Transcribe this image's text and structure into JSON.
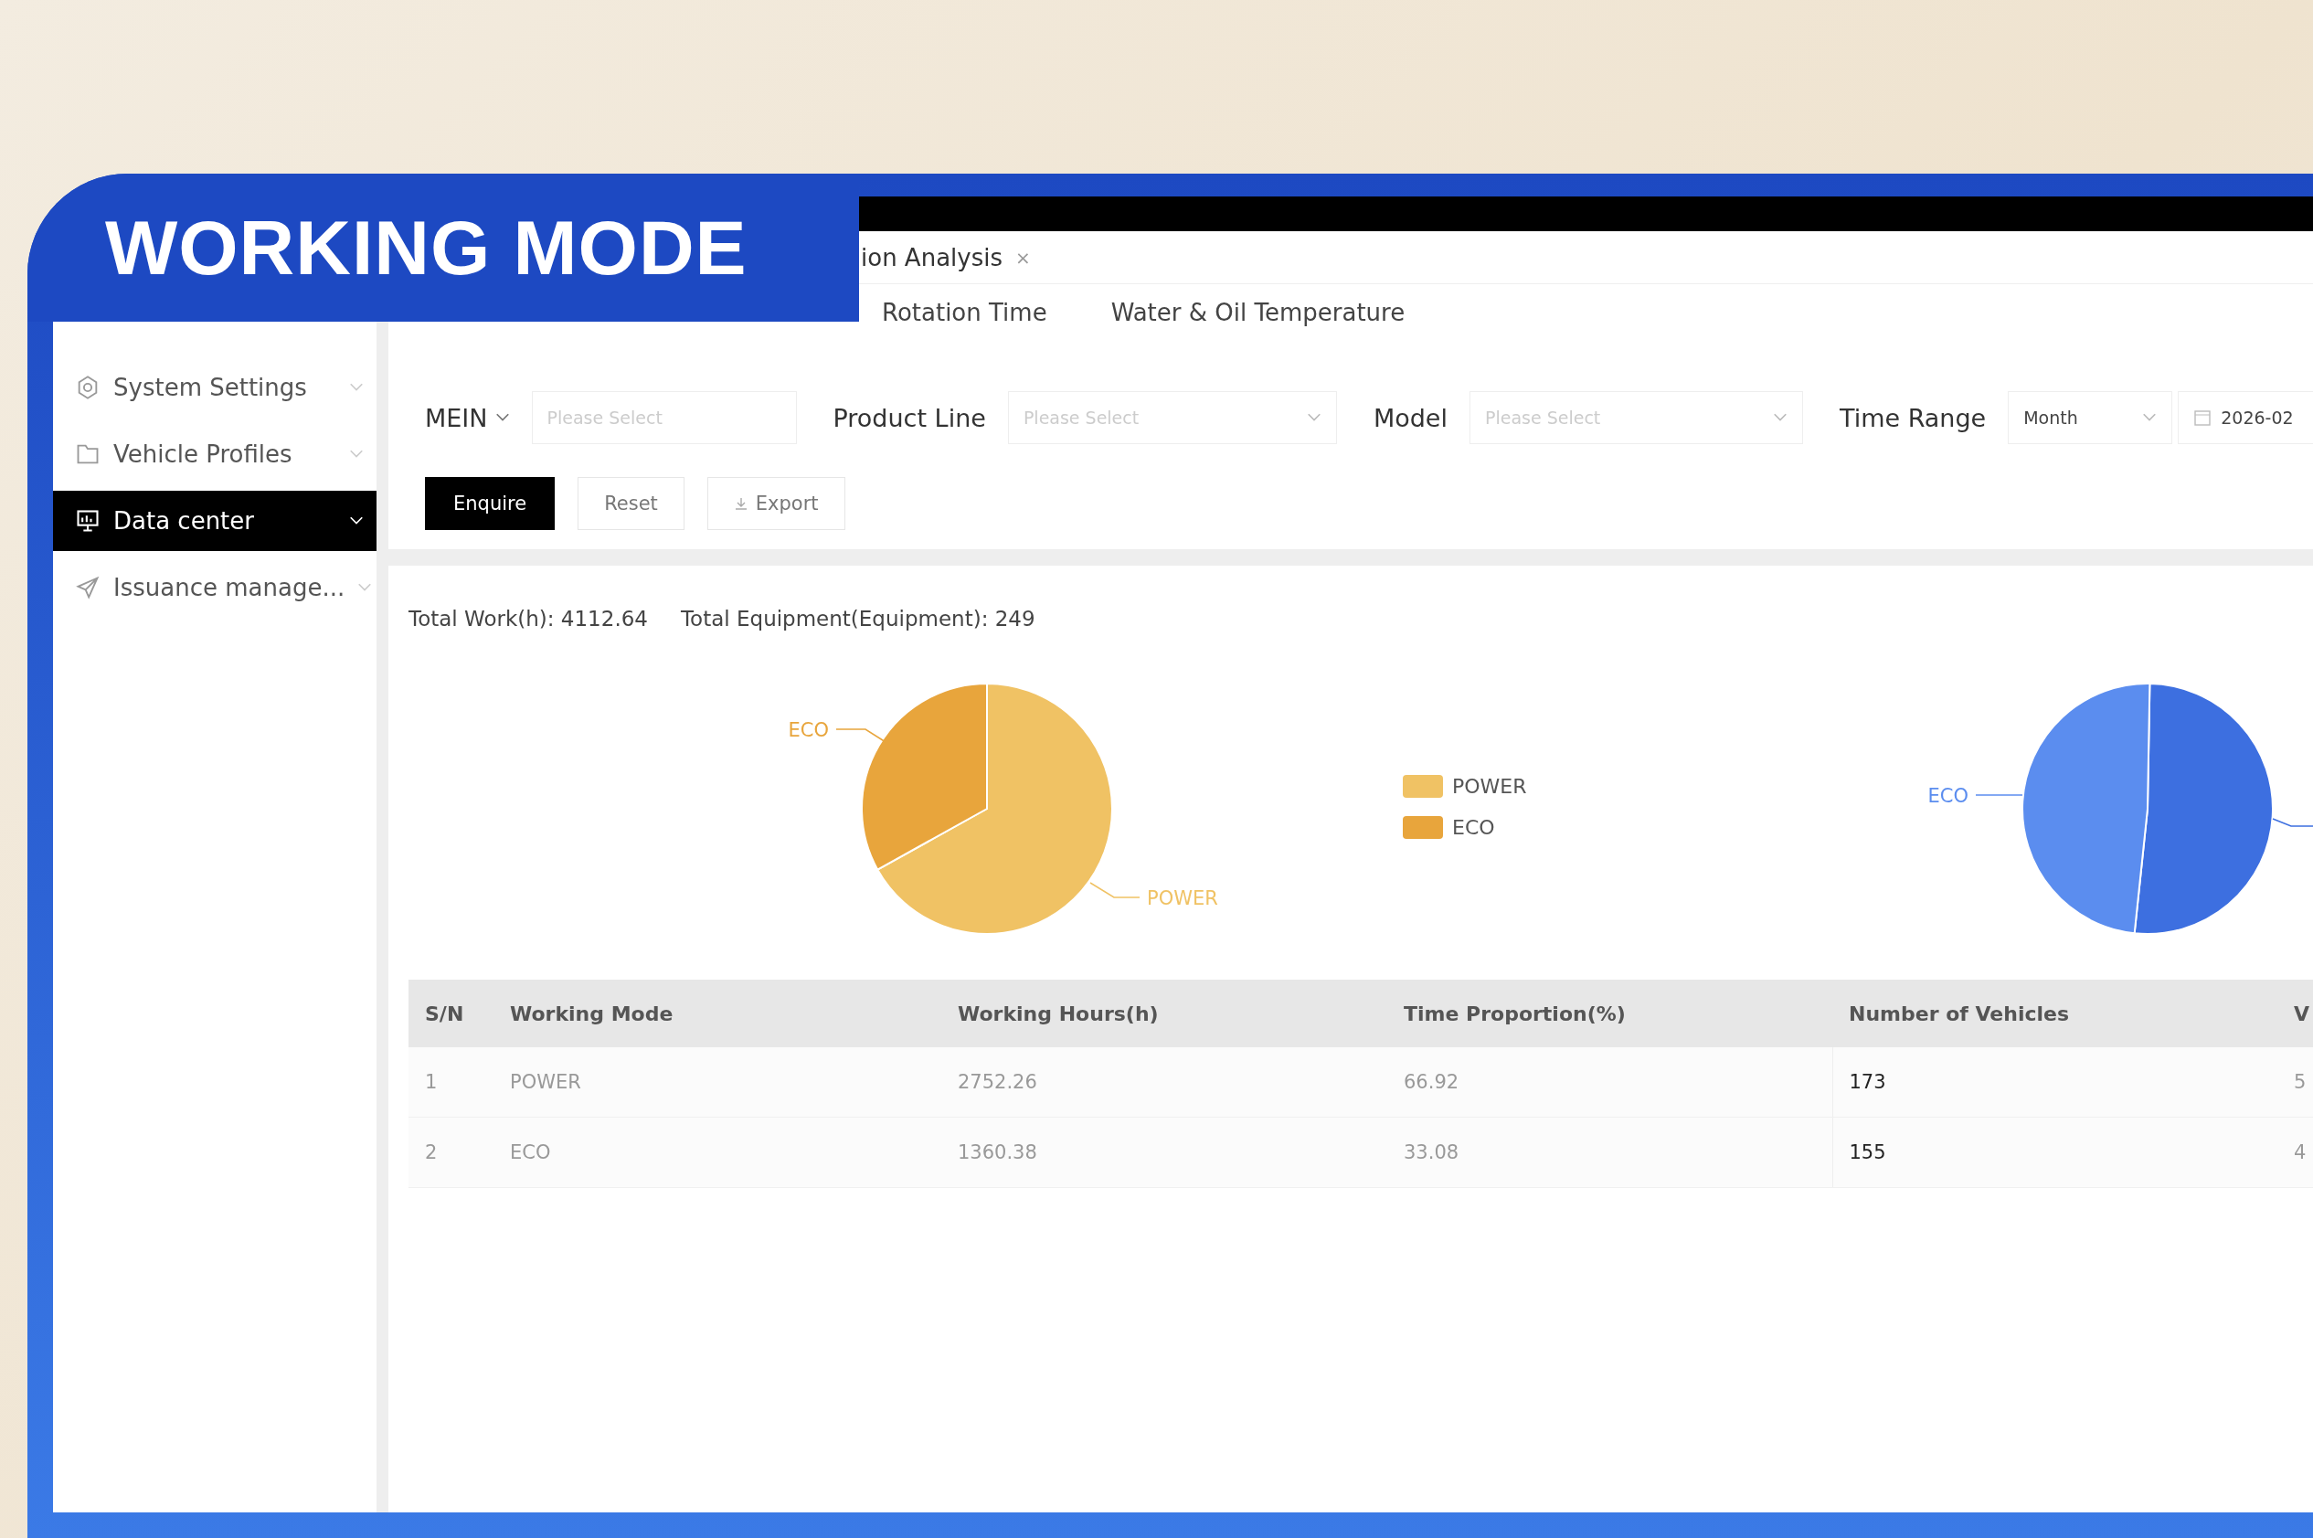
{
  "banner": {
    "title": "WORKING MODE"
  },
  "page_tab": {
    "label": "ion Analysis",
    "close": "×"
  },
  "sidebar": {
    "items": [
      {
        "label": "System Settings",
        "selected": false
      },
      {
        "label": "Vehicle Profiles",
        "selected": false
      },
      {
        "label": "Data center",
        "selected": true
      },
      {
        "label": "Issuance manage...",
        "selected": false
      }
    ]
  },
  "sub_tabs": [
    {
      "label": "Rotation Time",
      "selected": false
    },
    {
      "label": "Water & Oil Temperature",
      "selected": false
    }
  ],
  "filters": [
    {
      "kind": "dropdown",
      "label": "MEIN",
      "placeholder": "Please Select"
    },
    {
      "kind": "select",
      "label": "Product Line",
      "placeholder": "Please Select"
    },
    {
      "kind": "select",
      "label": "Model",
      "placeholder": "Please Select"
    },
    {
      "kind": "value",
      "label": "Time Range",
      "value": "Month"
    },
    {
      "kind": "date",
      "value": "2026-02"
    }
  ],
  "buttons": [
    {
      "label": "Enquire",
      "kind": "primary"
    },
    {
      "label": "Reset",
      "kind": "default"
    },
    {
      "label": "Export",
      "kind": "export"
    }
  ],
  "summary": [
    "Total Work(h): 4112.64",
    "Total Equipment(Equipment): 249"
  ],
  "working_hours_pie": {
    "labels": [
      "ECO",
      "POWER"
    ],
    "legend": [
      {
        "label": "POWER",
        "color": "#f0c264"
      },
      {
        "label": "ECO",
        "color": "#e8a53c"
      }
    ]
  },
  "vehicles_pie": {
    "labels": [
      "ECO"
    ]
  },
  "table": {
    "columns": [
      "S/N",
      "Working Mode",
      "Working Hours(h)",
      "Time Proportion(%)",
      "Number of Vehicles",
      "V"
    ],
    "rows": [
      [
        "1",
        "POWER",
        "2752.26",
        "66.92",
        "173",
        "5"
      ],
      [
        "2",
        "ECO",
        "1360.38",
        "33.08",
        "155",
        "4"
      ]
    ]
  }
}
